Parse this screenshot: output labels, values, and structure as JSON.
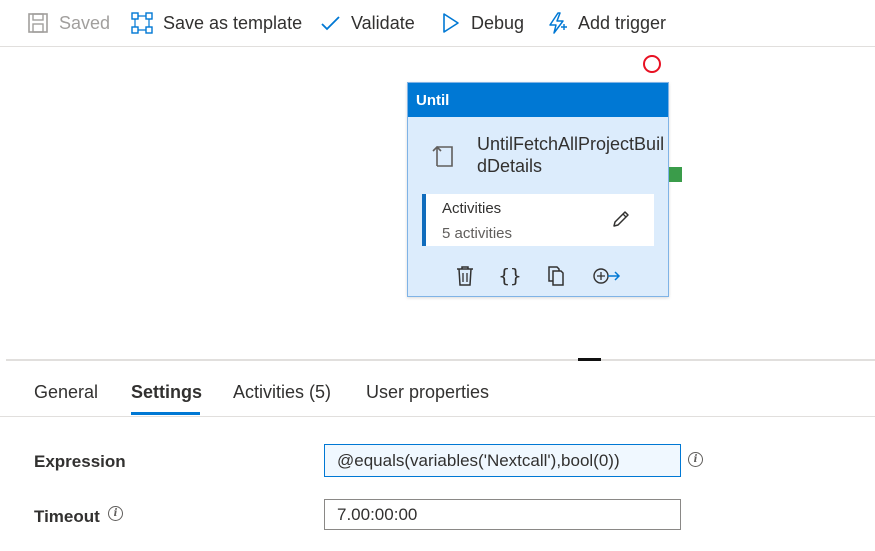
{
  "toolbar": {
    "saved_label": "Saved",
    "save_template_label": "Save as template",
    "validate_label": "Validate",
    "debug_label": "Debug",
    "add_trigger_label": "Add trigger"
  },
  "canvas": {
    "until_node": {
      "type_label": "Until",
      "name": "UntilFetchAllProjectBuildDetails",
      "activities_title": "Activities",
      "activities_count": "5 activities"
    }
  },
  "tabs": [
    {
      "label": "General",
      "active": false
    },
    {
      "label": "Settings",
      "active": true
    },
    {
      "label": "Activities (5)",
      "active": false
    },
    {
      "label": "User properties",
      "active": false
    }
  ],
  "settings": {
    "expression_label": "Expression",
    "expression_value": "@equals(variables('Nextcall'),bool(0))",
    "timeout_label": "Timeout",
    "timeout_value": "7.00:00:00"
  },
  "colors": {
    "accent": "#0078d4",
    "node_bg": "#dcecfc",
    "port": "#3a9c4a",
    "marker": "#e81123"
  }
}
